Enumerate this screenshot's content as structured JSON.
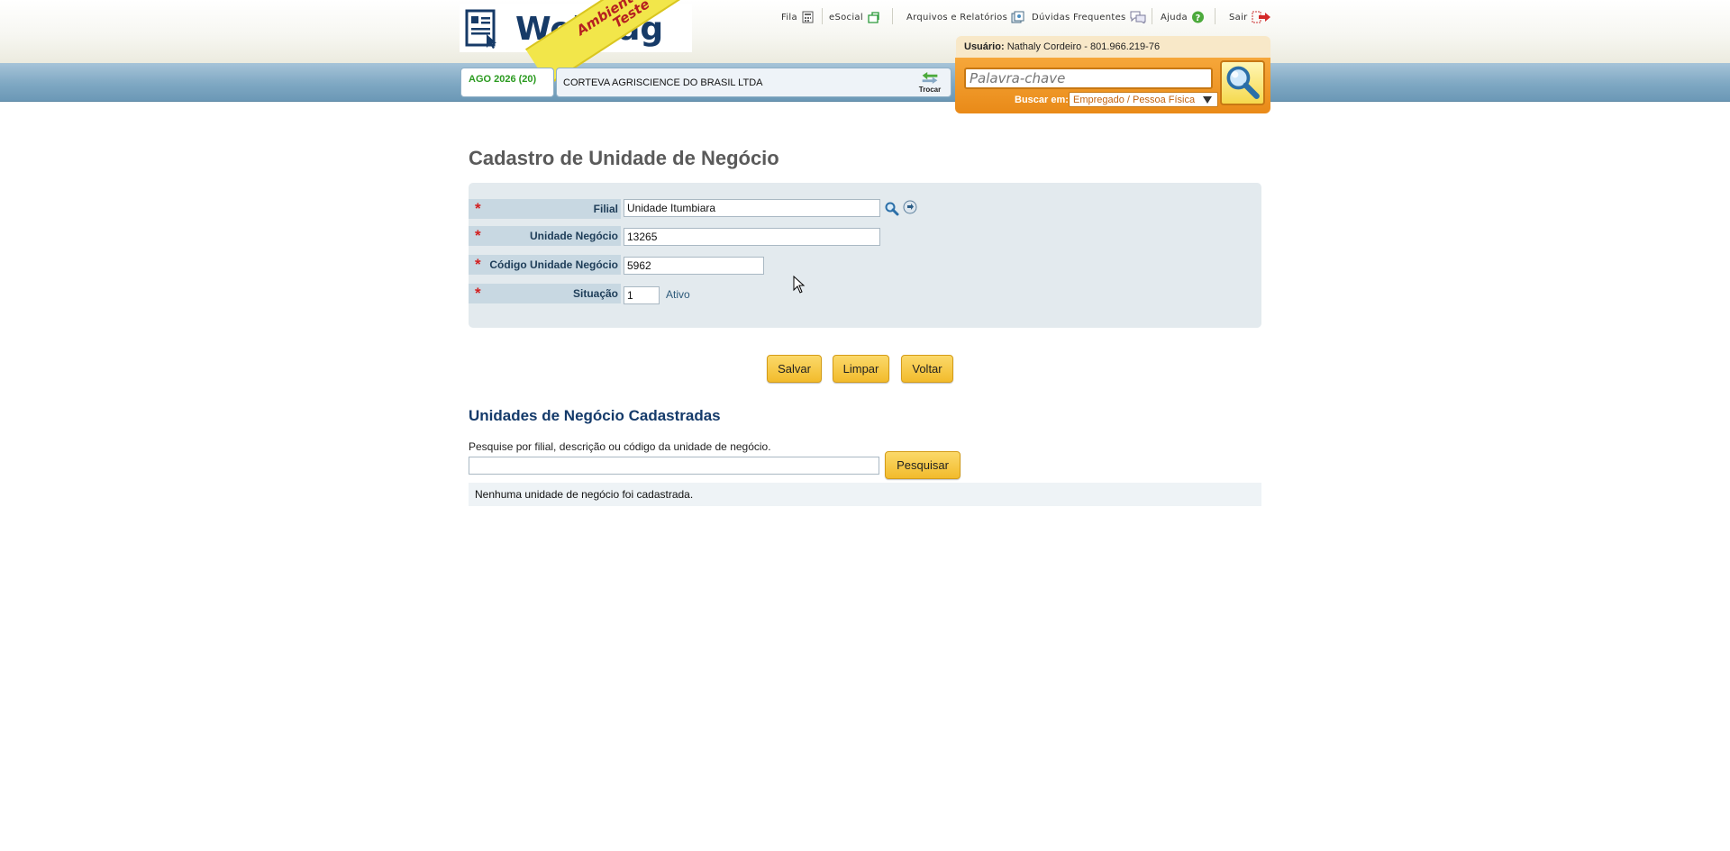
{
  "header": {
    "logo_text": "WebPag",
    "ribbon_line1": "Ambiente",
    "ribbon_line2": "Teste",
    "nav": {
      "fila": "Fila",
      "esocial": "eSocial",
      "arquivos": "Arquivos e Relatórios",
      "duvidas": "Dúvidas Frequentes",
      "ajuda": "Ajuda",
      "sair": "Sair"
    },
    "user_label": "Usuário:",
    "user_value": "Nathaly Cordeiro - 801.966.219-76",
    "search": {
      "placeholder": "Palavra-chave",
      "buscar_label": "Buscar em:",
      "buscar_option": "Empregado / Pessoa Física"
    },
    "competence": "AGO 2026 (20)",
    "company": "CORTEVA AGRISCIENCE DO BRASIL LTDA",
    "trocar": "Trocar"
  },
  "form": {
    "title": "Cadastro de Unidade de Negócio",
    "required_mark": "*",
    "filial_label": "Filial",
    "filial_value": "Unidade Itumbiara",
    "unidade_label": "Unidade Negócio",
    "unidade_value": "13265",
    "codigo_label": "Código Unidade Negócio",
    "codigo_value": "5962",
    "situacao_label": "Situação",
    "situacao_value": "1",
    "situacao_text": "Ativo"
  },
  "buttons": {
    "salvar": "Salvar",
    "limpar": "Limpar",
    "voltar": "Voltar",
    "pesquisar": "Pesquisar"
  },
  "list": {
    "title": "Unidades de Negócio Cadastradas",
    "hint": "Pesquise por filial, descrição ou código da unidade de negócio.",
    "search_value": "",
    "empty_message": "Nenhuma unidade de negócio foi cadastrada."
  },
  "colors": {
    "accent_orange": "#e98a18",
    "button_yellow": "#f2bb2c",
    "title_blue": "#143a6a",
    "required_red": "#d21f1f"
  }
}
